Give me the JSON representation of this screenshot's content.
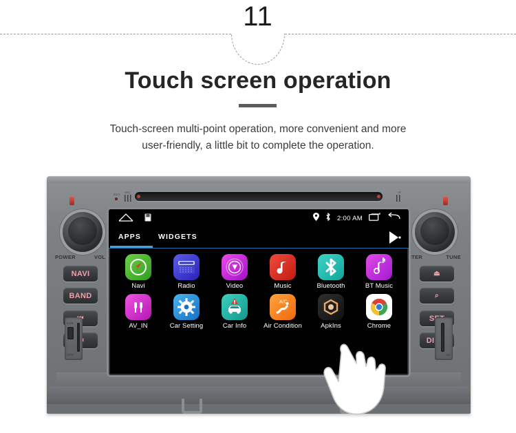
{
  "header": {
    "step_number": "11",
    "title": "Touch screen operation",
    "subtitle_line1": "Touch-screen multi-point operation, more convenient and more",
    "subtitle_line2": "user-friendly, a little bit to complete the operation."
  },
  "colors": {
    "accent_blue": "#3aa5e0",
    "unit_gray": "#7a7d80",
    "button_label_red": "#f0a0a8",
    "screen_black": "#000000"
  },
  "head_unit": {
    "top_panel": {
      "reset_label": "RES",
      "mic_label": "MIC",
      "ir_label": "IR"
    },
    "left_controls": {
      "knob_label_left": "POWER",
      "knob_label_right": "VOL",
      "buttons": [
        {
          "label": "NAVI",
          "name": "navi-button"
        },
        {
          "label": "BAND",
          "name": "band-button"
        },
        {
          "label": "⏮",
          "name": "previous-track-button"
        },
        {
          "label": "⏭",
          "name": "next-track-button"
        }
      ]
    },
    "right_controls": {
      "knob_label_left": "ENTER",
      "knob_label_right": "TUNE",
      "buttons": [
        {
          "label": "⏏",
          "name": "eject-button"
        },
        {
          "label": "⌕",
          "name": "phone-button"
        },
        {
          "label": "SET",
          "name": "set-button"
        },
        {
          "label": "DIMM",
          "name": "dimm-button"
        }
      ]
    },
    "bottom_slots": {
      "usb_label": "USB",
      "gps_label": "GPS",
      "sd_label": "SD"
    }
  },
  "screen": {
    "statusbar": {
      "home_icon": "home-icon",
      "sdcard_icon": "sdcard-icon",
      "location_icon": "location-pin-icon",
      "bluetooth_icon": "bluetooth-icon",
      "time": "2:00 AM",
      "recents_icon": "recents-icon",
      "back_icon": "back-arrow-icon"
    },
    "tabs": [
      {
        "label": "APPS",
        "active": true
      },
      {
        "label": "WIDGETS",
        "active": false
      }
    ],
    "playstore_icon": "play-store-icon",
    "apps": [
      [
        {
          "label": "Navi",
          "icon": "navi-compass-icon",
          "bg1": "#6fd14a",
          "bg2": "#2f9c1e"
        },
        {
          "label": "Radio",
          "icon": "radio-icon",
          "bg1": "#5b5de8",
          "bg2": "#2a21b8"
        },
        {
          "label": "Video",
          "icon": "video-play-icon",
          "bg1": "#e84be8",
          "bg2": "#a311c7"
        },
        {
          "label": "Music",
          "icon": "music-note-icon",
          "bg1": "#ef4b3d",
          "bg2": "#c31a10"
        },
        {
          "label": "Bluetooth",
          "icon": "bluetooth-icon",
          "bg1": "#3fd4c8",
          "bg2": "#12a49a"
        },
        {
          "label": "BT Music",
          "icon": "bt-music-icon",
          "bg1": "#e24be8",
          "bg2": "#a11ad1"
        }
      ],
      [
        {
          "label": "AV_IN",
          "icon": "rca-plug-icon",
          "bg1": "#ef54e0",
          "bg2": "#b517b5"
        },
        {
          "label": "Car Setting",
          "icon": "gear-icon",
          "bg1": "#4ab4f0",
          "bg2": "#1370c4"
        },
        {
          "label": "Car Info",
          "icon": "car-warning-icon",
          "bg1": "#3fd0bd",
          "bg2": "#11998e"
        },
        {
          "label": "Air Condition",
          "icon": "air-condition-icon",
          "bg1": "#ffa33d",
          "bg2": "#f0690d"
        },
        {
          "label": "ApkIns",
          "icon": "apk-installer-icon",
          "bg1": "#2b2b2b",
          "bg2": "#111111"
        },
        {
          "label": "Chrome",
          "icon": "chrome-icon",
          "bg1": "#ffffff",
          "bg2": "#e8e8e8"
        }
      ]
    ]
  },
  "cursor": {
    "icon": "pointing-hand-cursor"
  }
}
